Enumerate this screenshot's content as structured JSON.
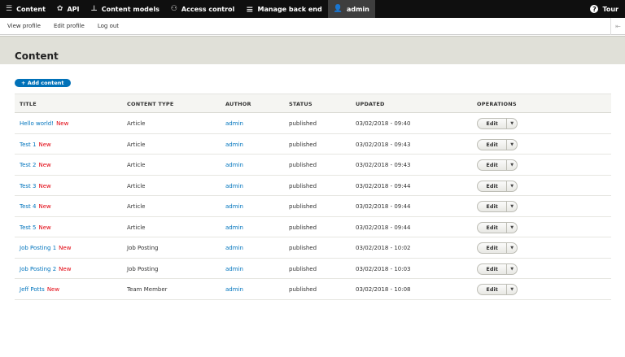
{
  "toolbar": {
    "items": [
      {
        "label": "Content",
        "icon": "menu-icon"
      },
      {
        "label": "API",
        "icon": "api-icon"
      },
      {
        "label": "Content models",
        "icon": "structure-icon"
      },
      {
        "label": "Access control",
        "icon": "people-icon"
      },
      {
        "label": "Manage back end",
        "icon": "hamburger-icon"
      },
      {
        "label": "admin",
        "icon": "user-icon"
      }
    ],
    "tour": "Tour"
  },
  "tray": {
    "links": [
      "View profile",
      "Edit profile",
      "Log out"
    ]
  },
  "page": {
    "title": "Content",
    "add_button": "+ Add content"
  },
  "table": {
    "headers": [
      "TITLE",
      "CONTENT TYPE",
      "AUTHOR",
      "STATUS",
      "UPDATED",
      "OPERATIONS"
    ],
    "new_label": "New",
    "edit_label": "Edit",
    "rows": [
      {
        "title": "Hello world!",
        "type": "Article",
        "author": "admin",
        "status": "published",
        "updated": "03/02/2018 - 09:40"
      },
      {
        "title": "Test 1",
        "type": "Article",
        "author": "admin",
        "status": "published",
        "updated": "03/02/2018 - 09:43"
      },
      {
        "title": "Test 2",
        "type": "Article",
        "author": "admin",
        "status": "published",
        "updated": "03/02/2018 - 09:43"
      },
      {
        "title": "Test 3",
        "type": "Article",
        "author": "admin",
        "status": "published",
        "updated": "03/02/2018 - 09:44"
      },
      {
        "title": "Test 4",
        "type": "Article",
        "author": "admin",
        "status": "published",
        "updated": "03/02/2018 - 09:44"
      },
      {
        "title": "Test 5",
        "type": "Article",
        "author": "admin",
        "status": "published",
        "updated": "03/02/2018 - 09:44"
      },
      {
        "title": "Job Posting 1",
        "type": "Job Posting",
        "author": "admin",
        "status": "published",
        "updated": "03/02/2018 - 10:02"
      },
      {
        "title": "Job Posting 2",
        "type": "Job Posting",
        "author": "admin",
        "status": "published",
        "updated": "03/02/2018 - 10:03"
      },
      {
        "title": "Jeff Potts",
        "type": "Team Member",
        "author": "admin",
        "status": "published",
        "updated": "03/02/2018 - 10:08"
      }
    ]
  },
  "colors": {
    "toolbar_bg": "#0f0f0f",
    "accent": "#0071b8",
    "link": "#0074bd",
    "new": "#e2000c"
  }
}
